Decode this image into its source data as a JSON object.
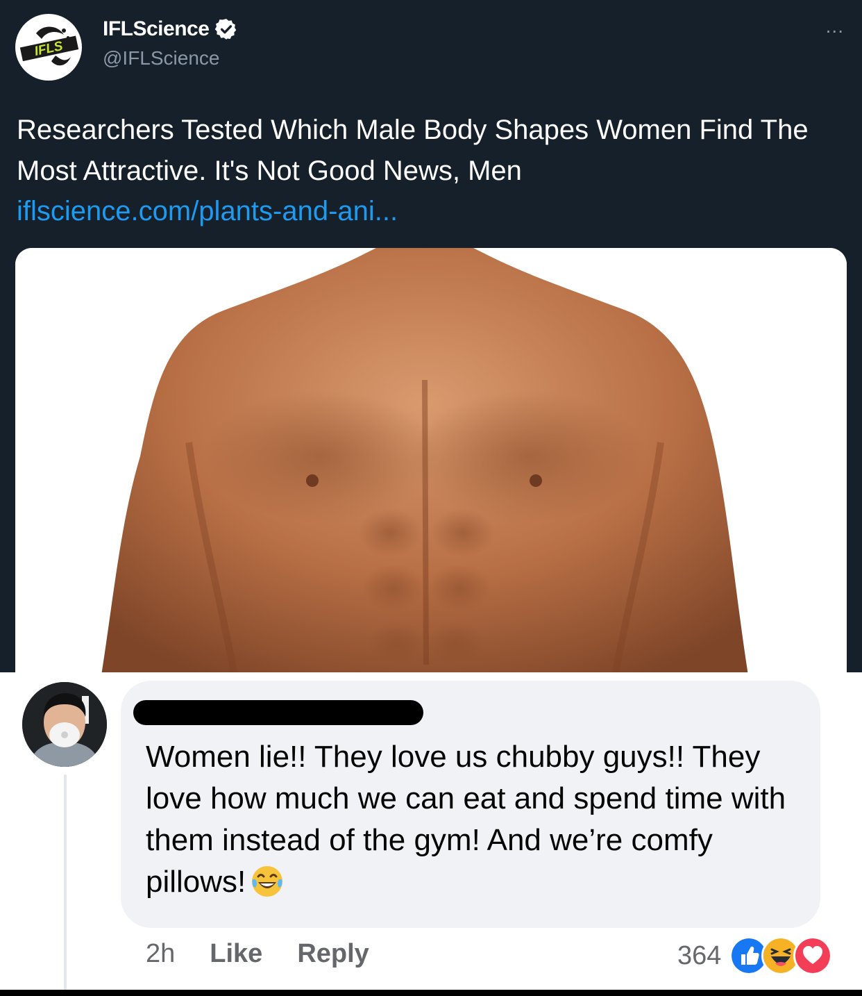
{
  "tweet": {
    "display_name": "IFLScience",
    "handle": "@IFLScience",
    "more_label": "...",
    "logo_text": "IFLS",
    "text": "Researchers Tested Which Male Body Shapes Women Find The Most Attractive. It's Not Good News, Men",
    "link": "iflscience.com/plants-and-ani...",
    "colors": {
      "background": "#15202b",
      "link": "#1d9bf0",
      "verified": "#ffffff"
    },
    "icons": [
      "ifls-logo-icon",
      "verified-badge-icon"
    ]
  },
  "comment": {
    "text": "Women lie!! They love us chubby guys!! They love how much we can eat and spend time with them instead of the gym! And we’re comfy pillows!",
    "emoji": "laughing-tears-emoji",
    "time": "2h",
    "like_label": "Like",
    "reply_label": "Reply",
    "reaction_count": "364",
    "reactions": [
      "like-reaction-icon",
      "haha-reaction-icon",
      "love-reaction-icon"
    ],
    "colors": {
      "bubble": "#f0f2f5",
      "meta": "#65676b",
      "like": "#1877f2",
      "love": "#f33e58",
      "haha": "#f7b125"
    }
  }
}
